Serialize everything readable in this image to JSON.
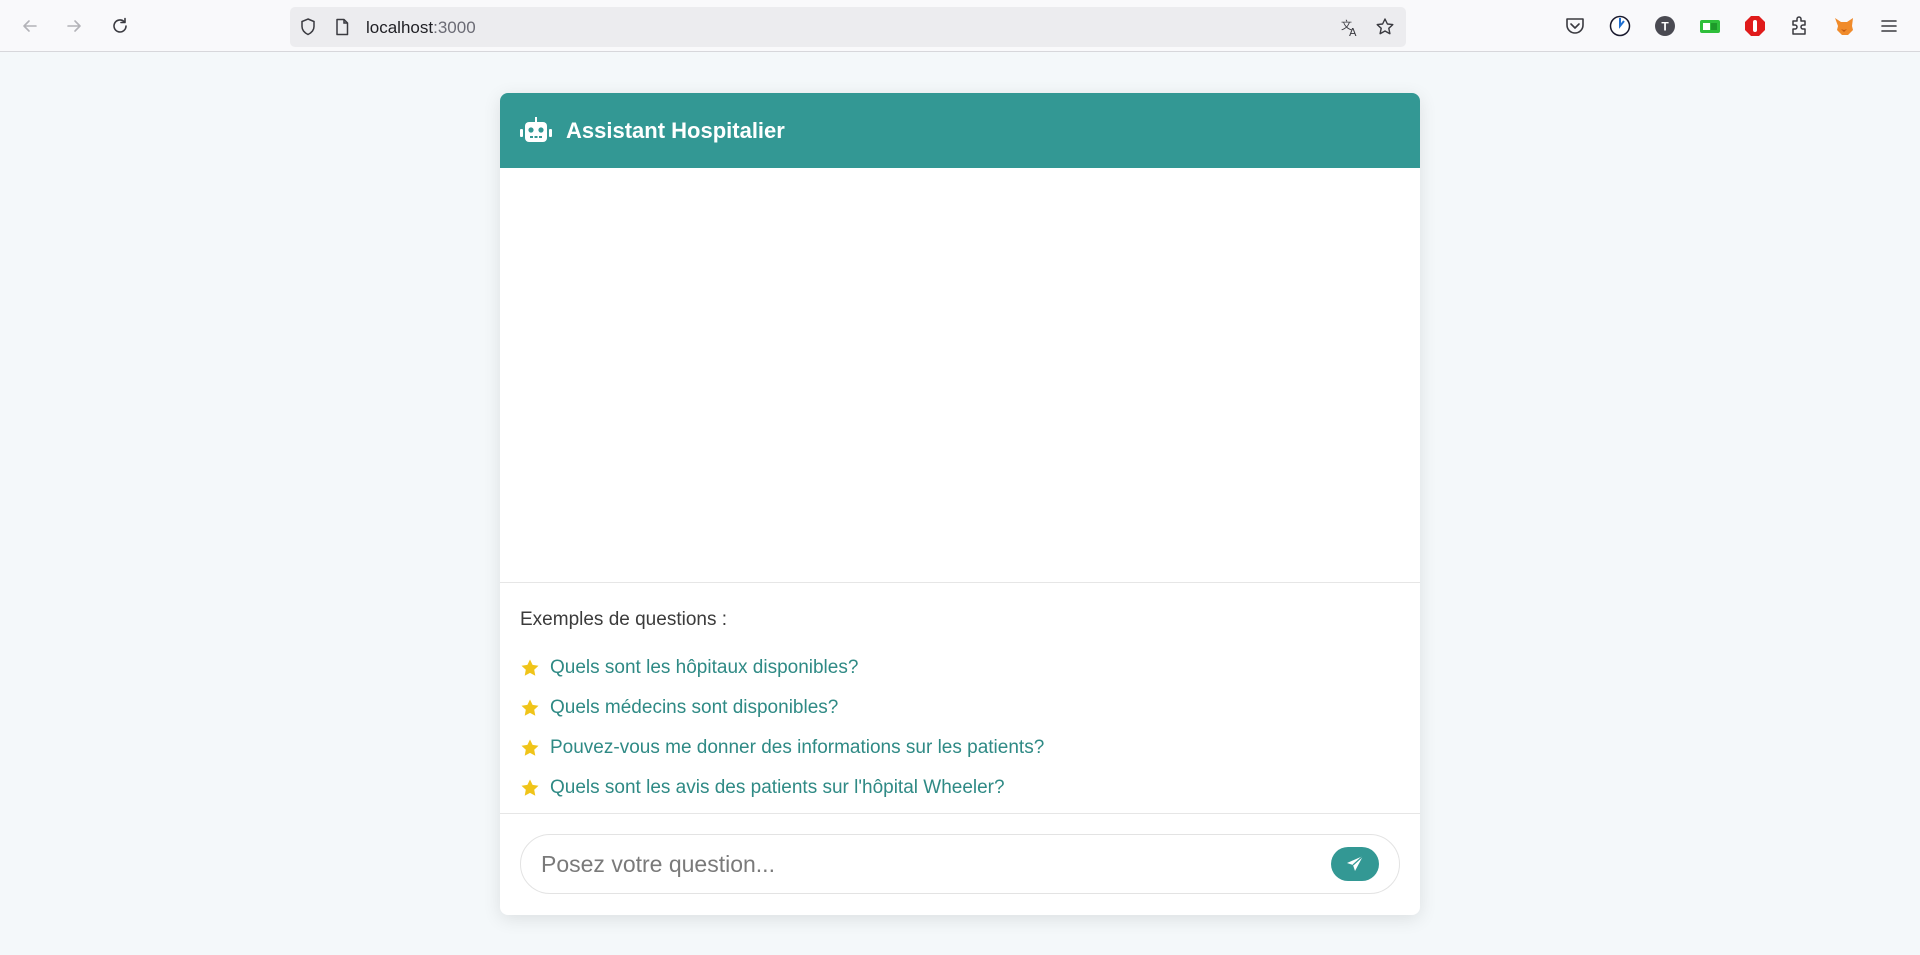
{
  "browser": {
    "url_host": "localhost",
    "url_port": ":3000",
    "icons": [
      "back-icon",
      "forward-icon",
      "reload-icon",
      "shield-icon",
      "page-icon",
      "translate-icon",
      "bookmark-star-icon",
      "pocket-icon",
      "timer-extension-icon",
      "t-extension-icon",
      "green-extension-icon",
      "stop-extension-icon",
      "puzzle-extensions-icon",
      "fox-extension-icon",
      "menu-icon"
    ]
  },
  "chat": {
    "title": "Assistant Hospitalier",
    "header_icon": "robot-icon",
    "accent_color": "#339894",
    "examples_title": "Exemples de questions :",
    "examples": [
      "Quels sont les hôpitaux disponibles?",
      "Quels médecins sont disponibles?",
      "Pouvez-vous me donner des informations sur les patients?",
      "Quels sont les avis des patients sur l'hôpital Wheeler?"
    ],
    "example_icon": "star-icon",
    "star_color": "#f0c419",
    "input_placeholder": "Posez votre question...",
    "send_icon": "paper-plane-icon"
  }
}
